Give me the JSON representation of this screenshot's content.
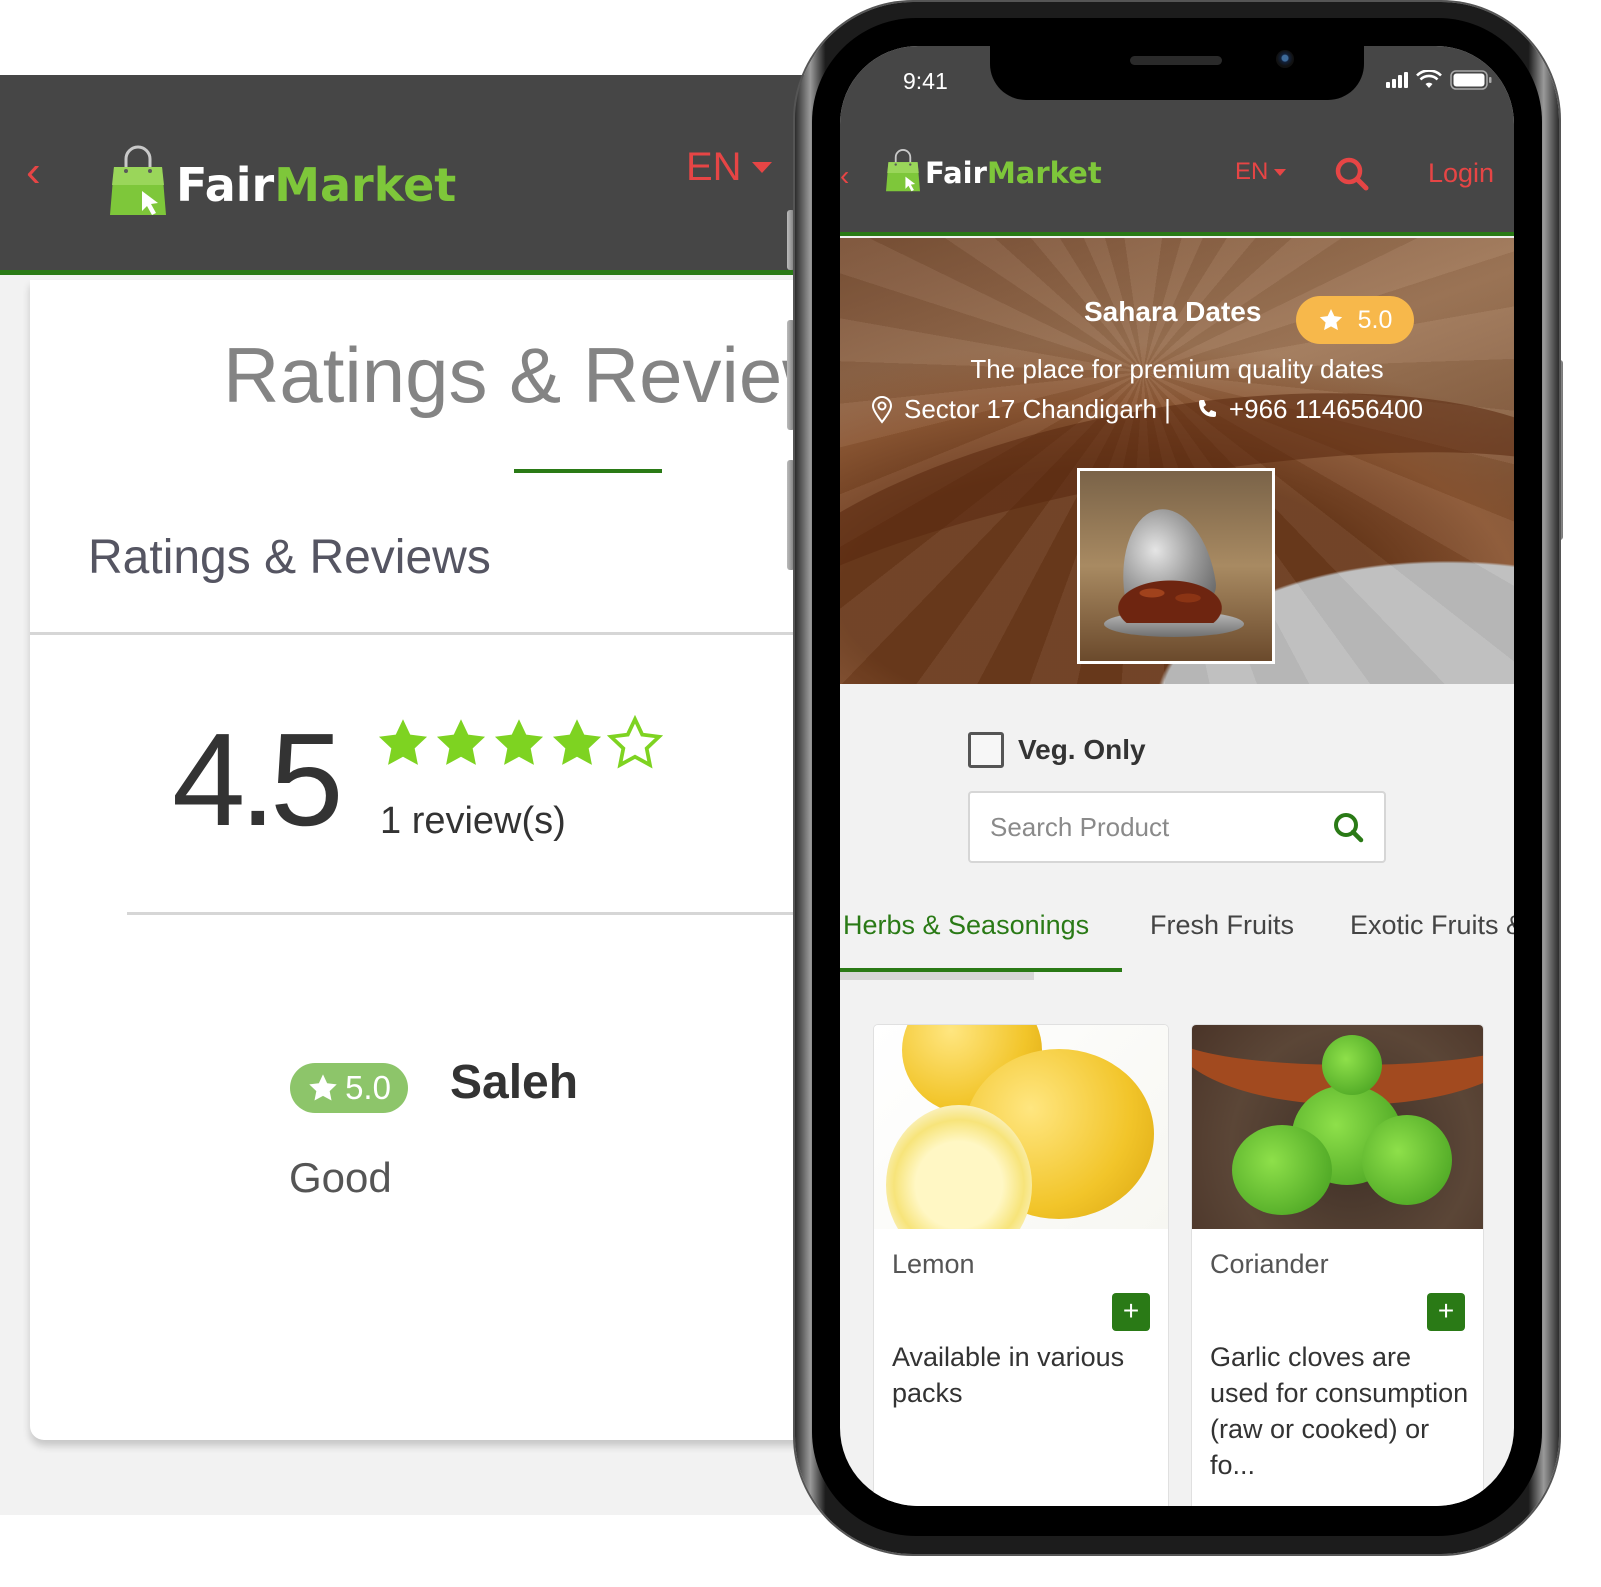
{
  "brand": {
    "name_part1": "Fair",
    "name_part2": "Market",
    "accent": "#2a7a16",
    "logo_green": "#7ec73a",
    "header_bg": "#464646",
    "link_red": "#e64545"
  },
  "desktop": {
    "back_icon": "chevron-left-icon",
    "language": "EN",
    "page_title": "Ratings & Reviews",
    "section_title": "Ratings & Reviews",
    "summary": {
      "average": "4.5",
      "stars_filled": 4,
      "stars_total": 5,
      "review_count": "1 review(s)"
    },
    "reviews": [
      {
        "rating": "5.0",
        "name": "Saleh",
        "comment": "Good"
      }
    ]
  },
  "phone": {
    "status_bar": {
      "time": "9:41"
    },
    "header": {
      "language": "EN",
      "login_label": "Login"
    },
    "store": {
      "name": "Sahara Dates",
      "rating": "5.0",
      "tagline": "The place for premium quality dates",
      "address": "Sector 17 Chandigarh |",
      "phone": "+966 114656400"
    },
    "filters": {
      "veg_only_label": "Veg. Only",
      "veg_only_checked": false
    },
    "search": {
      "placeholder": "Search Product",
      "value": ""
    },
    "tabs": [
      {
        "label": "Herbs & Seasonings",
        "active": true
      },
      {
        "label": "Fresh Fruits",
        "active": false
      },
      {
        "label": "Exotic Fruits &",
        "active": false
      }
    ],
    "products": [
      {
        "name": "Lemon",
        "description": "Available in various packs",
        "add_label": "+"
      },
      {
        "name": "Coriander",
        "description": "Garlic cloves are used for consumption (raw or cooked) or fo...",
        "add_label": "+"
      }
    ]
  }
}
